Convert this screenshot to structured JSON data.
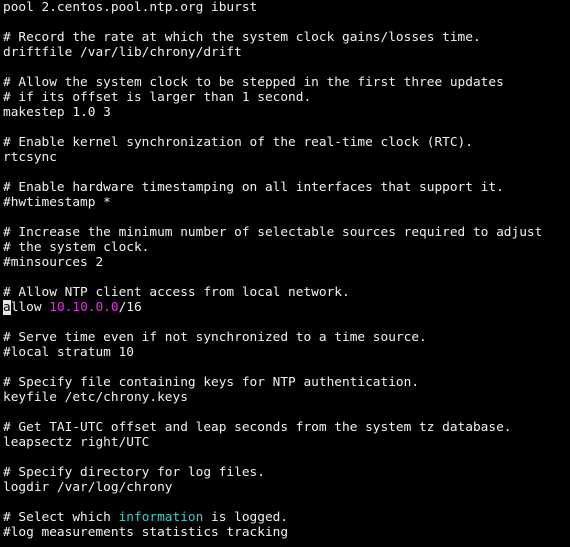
{
  "terminal": {
    "lines": [
      {
        "segments": [
          {
            "text": "pool 2.centos.pool.ntp.org iburst"
          }
        ]
      },
      {
        "segments": [
          {
            "text": ""
          }
        ]
      },
      {
        "segments": [
          {
            "text": "# Record the rate at which the system clock gains/losses time."
          }
        ]
      },
      {
        "segments": [
          {
            "text": "driftfile /var/lib/chrony/drift"
          }
        ]
      },
      {
        "segments": [
          {
            "text": ""
          }
        ]
      },
      {
        "segments": [
          {
            "text": "# Allow the system clock to be stepped in the first three updates"
          }
        ]
      },
      {
        "segments": [
          {
            "text": "# if its offset is larger than 1 second."
          }
        ]
      },
      {
        "segments": [
          {
            "text": "makestep 1.0 3"
          }
        ]
      },
      {
        "segments": [
          {
            "text": ""
          }
        ]
      },
      {
        "segments": [
          {
            "text": "# Enable kernel synchronization of the real-time clock (RTC)."
          }
        ]
      },
      {
        "segments": [
          {
            "text": "rtcsync"
          }
        ]
      },
      {
        "segments": [
          {
            "text": ""
          }
        ]
      },
      {
        "segments": [
          {
            "text": "# Enable hardware timestamping on all interfaces that support it."
          }
        ]
      },
      {
        "segments": [
          {
            "text": "#hwtimestamp *"
          }
        ]
      },
      {
        "segments": [
          {
            "text": ""
          }
        ]
      },
      {
        "segments": [
          {
            "text": "# Increase the minimum number of selectable sources required to adjust"
          }
        ]
      },
      {
        "segments": [
          {
            "text": "# the system clock."
          }
        ]
      },
      {
        "segments": [
          {
            "text": "#minsources 2"
          }
        ]
      },
      {
        "segments": [
          {
            "text": ""
          }
        ]
      },
      {
        "segments": [
          {
            "text": "# Allow NTP client access from local network."
          }
        ]
      },
      {
        "segments": [
          {
            "text": "a",
            "style": "cursor"
          },
          {
            "text": "llow "
          },
          {
            "text": "10.10.0.0",
            "style": "num"
          },
          {
            "text": "/16"
          }
        ]
      },
      {
        "segments": [
          {
            "text": ""
          }
        ]
      },
      {
        "segments": [
          {
            "text": "# Serve time even if not synchronized to a time source."
          }
        ]
      },
      {
        "segments": [
          {
            "text": "#local stratum 10"
          }
        ]
      },
      {
        "segments": [
          {
            "text": ""
          }
        ]
      },
      {
        "segments": [
          {
            "text": "# Specify file containing keys for NTP authentication."
          }
        ]
      },
      {
        "segments": [
          {
            "text": "keyfile /etc/chrony.keys"
          }
        ]
      },
      {
        "segments": [
          {
            "text": ""
          }
        ]
      },
      {
        "segments": [
          {
            "text": "# Get TAI-UTC offset and leap seconds from the system tz database."
          }
        ]
      },
      {
        "segments": [
          {
            "text": "leapsectz right/UTC"
          }
        ]
      },
      {
        "segments": [
          {
            "text": ""
          }
        ]
      },
      {
        "segments": [
          {
            "text": "# Specify directory for log files."
          }
        ]
      },
      {
        "segments": [
          {
            "text": "logdir /var/log/chrony"
          }
        ]
      },
      {
        "segments": [
          {
            "text": ""
          }
        ]
      },
      {
        "segments": [
          {
            "text": "# Select which "
          },
          {
            "text": "information",
            "style": "kw"
          },
          {
            "text": " is logged."
          }
        ]
      },
      {
        "segments": [
          {
            "text": "#log measurements statistics tracking"
          }
        ]
      }
    ],
    "colors": {
      "background": "#000000",
      "foreground": "#f0f0f0",
      "number_highlight": "#d63ad6",
      "keyword_highlight": "#45c8c8",
      "cursor": "#e8e8e8"
    }
  }
}
